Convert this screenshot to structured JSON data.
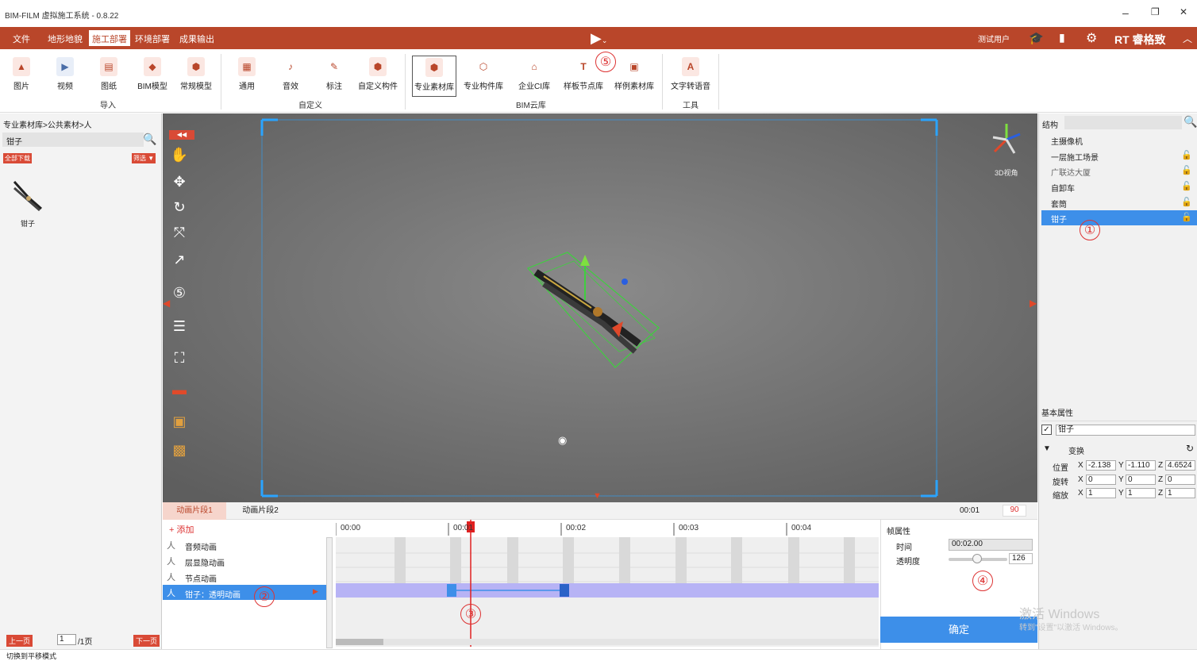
{
  "window": {
    "title": "BIM-FILM 虚拟施工系统 - 0.8.22",
    "min": "–",
    "max": "❐",
    "close": "✕"
  },
  "menu": {
    "items": [
      "文件",
      "地形地貌",
      "施工部署",
      "环境部署",
      "成果输出"
    ],
    "active": "施工部署",
    "user": "测试用户",
    "brand": "RT 睿格致"
  },
  "ribbon": {
    "import_group": "导入",
    "custom_group": "自定义",
    "cloud_group": "BIM云库",
    "tool_group": "工具",
    "buttons": [
      {
        "label": "图片",
        "icon": "image-icon"
      },
      {
        "label": "视频",
        "icon": "video-icon"
      },
      {
        "label": "图纸",
        "icon": "drawing-icon"
      },
      {
        "label": "BIM模型",
        "icon": "bim-model-icon"
      },
      {
        "label": "常规模型",
        "icon": "model-icon"
      },
      {
        "label": "通用",
        "icon": "grid-icon"
      },
      {
        "label": "音效",
        "icon": "music-icon"
      },
      {
        "label": "标注",
        "icon": "pen-icon"
      },
      {
        "label": "自定义构件",
        "icon": "cube-icon"
      },
      {
        "label": "专业素材库",
        "icon": "material-icon"
      },
      {
        "label": "专业构件库",
        "icon": "component-icon"
      },
      {
        "label": "企业CI库",
        "icon": "ci-icon"
      },
      {
        "label": "样板节点库",
        "icon": "template-icon"
      },
      {
        "label": "样例素材库",
        "icon": "sample-icon"
      },
      {
        "label": "文字转语音",
        "icon": "tts-icon"
      }
    ]
  },
  "left": {
    "breadcrumb": "专业素材库>公共素材>人",
    "search_value": "钳子",
    "download_all": "全部下载",
    "filter": "筛选 ▼",
    "item_label": "钳子",
    "prev": "上一页",
    "page": "1",
    "total": "/1页",
    "next": "下一页"
  },
  "viewport": {
    "view_label": "3D视角"
  },
  "right": {
    "structure_label": "结构",
    "tree": [
      "主摄像机",
      "一层施工场景",
      "广联达大厦",
      "自卸车",
      "套筒",
      "钳子"
    ],
    "selected": "钳子",
    "basic_props": "基本属性",
    "name_value": "钳子",
    "transform": "变换",
    "pos_label": "位置",
    "rot_label": "旋转",
    "scale_label": "缩放",
    "pos": {
      "x": "-2.138",
      "y": "-1.110",
      "z": "4.6524"
    },
    "rot": {
      "x": "0",
      "y": "0",
      "z": "0"
    },
    "scale": {
      "x": "1",
      "y": "1",
      "z": "1"
    }
  },
  "timeline": {
    "tabs": [
      "动画片段1",
      "动画片段2"
    ],
    "current_time": "00:01",
    "frames": "90",
    "add": "+ 添加",
    "tracks": [
      "音频动画",
      "层显隐动画",
      "节点动画",
      "钳子：透明动画"
    ],
    "ticks": [
      "00:00",
      "00:01",
      "00:02",
      "00:03",
      "00:04"
    ],
    "frame_props": "帧属性",
    "time_label": "时间",
    "time_value": "00:02.00",
    "opacity_label": "透明度",
    "opacity_value": "126",
    "opacity_fraction": 0.49,
    "confirm": "确定"
  },
  "annotations": [
    "①",
    "②",
    "③",
    "④",
    "⑤"
  ],
  "watermark": {
    "line1": "激活 Windows",
    "line2": "转到\"设置\"以激活 Windows。"
  },
  "status": "切换到平移模式"
}
